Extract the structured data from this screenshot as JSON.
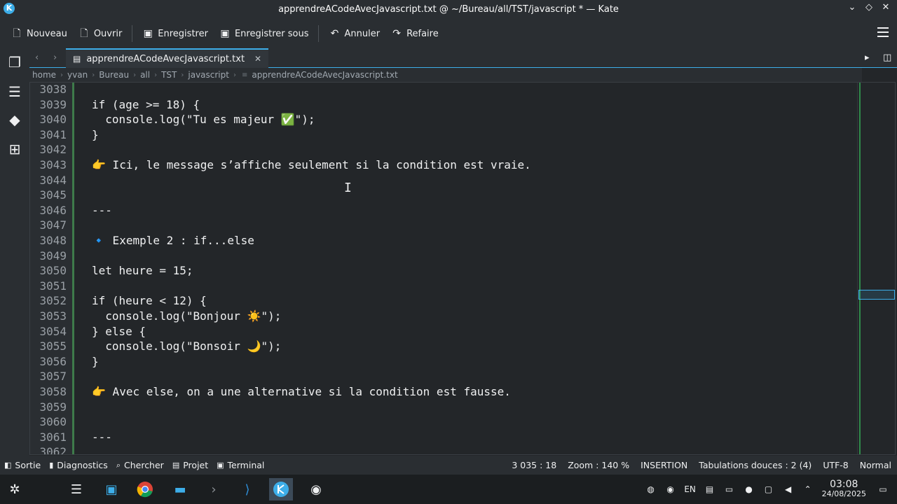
{
  "window": {
    "title": "apprendreACodeAvecJavascript.txt @ ~/Bureau/all/TST/javascript * — Kate",
    "controls": [
      "⌄",
      "◇",
      "✕"
    ]
  },
  "toolbar": {
    "new_label": "Nouveau",
    "open_label": "Ouvrir",
    "save_label": "Enregistrer",
    "save_as_label": "Enregistrer sous",
    "undo_label": "Annuler",
    "redo_label": "Refaire"
  },
  "tabs": {
    "active_label": "apprendreACodeAvecJavascript.txt"
  },
  "breadcrumb": [
    "home",
    "yvan",
    "Bureau",
    "all",
    "TST",
    "javascript",
    "apprendreACodeAvecJavascript.txt"
  ],
  "editor": {
    "lines": [
      {
        "num": "3038",
        "text": ""
      },
      {
        "num": "3039",
        "text": "if (age >= 18) {"
      },
      {
        "num": "3040",
        "text": "  console.log(\"Tu es majeur ✅\");"
      },
      {
        "num": "3041",
        "text": "}"
      },
      {
        "num": "3042",
        "text": ""
      },
      {
        "num": "3043",
        "text": "👉 Ici, le message s’affiche seulement si la condition est vraie."
      },
      {
        "num": "3044",
        "text": ""
      },
      {
        "num": "3045",
        "text": ""
      },
      {
        "num": "3046",
        "text": "---"
      },
      {
        "num": "3047",
        "text": ""
      },
      {
        "num": "3048",
        "text": "🔹 Exemple 2 : if...else"
      },
      {
        "num": "3049",
        "text": ""
      },
      {
        "num": "3050",
        "text": "let heure = 15;"
      },
      {
        "num": "3051",
        "text": ""
      },
      {
        "num": "3052",
        "text": "if (heure < 12) {"
      },
      {
        "num": "3053",
        "text": "  console.log(\"Bonjour ☀️\");"
      },
      {
        "num": "3054",
        "text": "} else {"
      },
      {
        "num": "3055",
        "text": "  console.log(\"Bonsoir 🌙\");"
      },
      {
        "num": "3056",
        "text": "}"
      },
      {
        "num": "3057",
        "text": ""
      },
      {
        "num": "3058",
        "text": "👉 Avec else, on a une alternative si la condition est fausse."
      },
      {
        "num": "3059",
        "text": ""
      },
      {
        "num": "3060",
        "text": ""
      },
      {
        "num": "3061",
        "text": "---"
      },
      {
        "num": "3062",
        "text": ""
      }
    ]
  },
  "statusbar": {
    "output_label": "Sortie",
    "diagnostics_label": "Diagnostics",
    "search_label": "Chercher",
    "project_label": "Projet",
    "terminal_label": "Terminal",
    "cursor_pos": "3 035 : 18",
    "zoom": "Zoom : 140 %",
    "mode": "INSERTION",
    "tabs": "Tabulations douces : 2 (4)",
    "encoding": "UTF-8",
    "highlight": "Normal"
  },
  "taskbar": {
    "lang": "EN",
    "time": "03:08",
    "date": "24/08/2025"
  },
  "colors": {
    "accent": "#3daee9",
    "fold_marker": "#3e7a4a"
  }
}
